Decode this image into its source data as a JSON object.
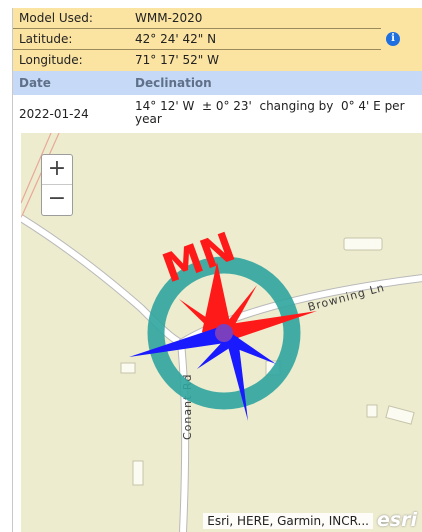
{
  "info": {
    "rows": [
      {
        "key": "Model Used:",
        "value": "WMM-2020"
      },
      {
        "key": "Latitude:",
        "value": "42° 24' 42\" N"
      },
      {
        "key": "Longitude:",
        "value": "71° 17' 52\" W"
      }
    ],
    "info_icon": "info-icon"
  },
  "table": {
    "headers": {
      "date": "Date",
      "declination": "Declination"
    },
    "row": {
      "date": "2022-01-24",
      "declination": "14° 12' W  ± 0° 23'  changing by  0° 4' E per year"
    }
  },
  "map": {
    "zoom_in": "+",
    "zoom_out": "−",
    "roads": [
      "Browning Ln",
      "Conant Rd"
    ],
    "overlay_label": "MN",
    "attribution": "Esri, HERE, Garmin, INCR...",
    "logo": "esri",
    "colors": {
      "background": "#eeeccf",
      "ring": "#2fa59e",
      "mn": "#ff1a1a",
      "north": "#ff1a1a",
      "south": "#1a1aff"
    }
  }
}
